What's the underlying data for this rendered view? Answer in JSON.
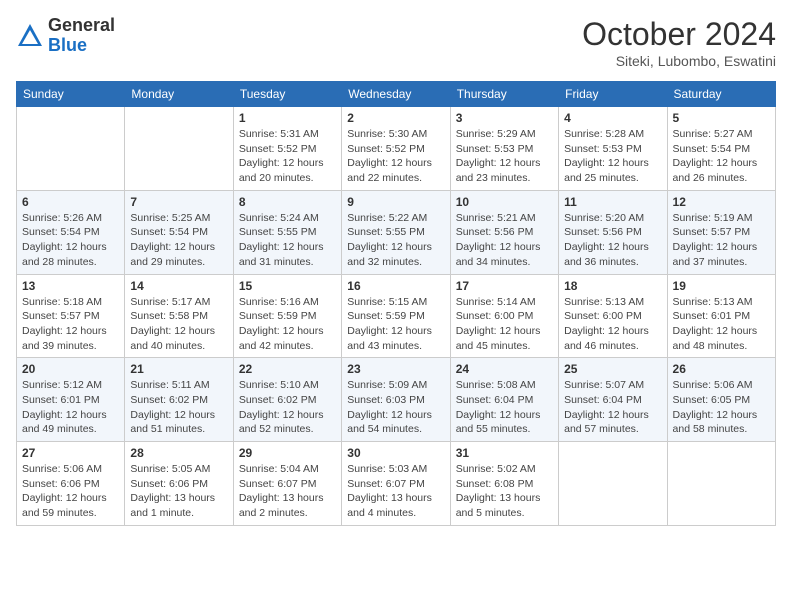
{
  "header": {
    "logo_line1": "General",
    "logo_line2": "Blue",
    "month": "October 2024",
    "location": "Siteki, Lubombo, Eswatini"
  },
  "days_of_week": [
    "Sunday",
    "Monday",
    "Tuesday",
    "Wednesday",
    "Thursday",
    "Friday",
    "Saturday"
  ],
  "weeks": [
    [
      {
        "day": "",
        "info": ""
      },
      {
        "day": "",
        "info": ""
      },
      {
        "day": "1",
        "info": "Sunrise: 5:31 AM\nSunset: 5:52 PM\nDaylight: 12 hours and 20 minutes."
      },
      {
        "day": "2",
        "info": "Sunrise: 5:30 AM\nSunset: 5:52 PM\nDaylight: 12 hours and 22 minutes."
      },
      {
        "day": "3",
        "info": "Sunrise: 5:29 AM\nSunset: 5:53 PM\nDaylight: 12 hours and 23 minutes."
      },
      {
        "day": "4",
        "info": "Sunrise: 5:28 AM\nSunset: 5:53 PM\nDaylight: 12 hours and 25 minutes."
      },
      {
        "day": "5",
        "info": "Sunrise: 5:27 AM\nSunset: 5:54 PM\nDaylight: 12 hours and 26 minutes."
      }
    ],
    [
      {
        "day": "6",
        "info": "Sunrise: 5:26 AM\nSunset: 5:54 PM\nDaylight: 12 hours and 28 minutes."
      },
      {
        "day": "7",
        "info": "Sunrise: 5:25 AM\nSunset: 5:54 PM\nDaylight: 12 hours and 29 minutes."
      },
      {
        "day": "8",
        "info": "Sunrise: 5:24 AM\nSunset: 5:55 PM\nDaylight: 12 hours and 31 minutes."
      },
      {
        "day": "9",
        "info": "Sunrise: 5:22 AM\nSunset: 5:55 PM\nDaylight: 12 hours and 32 minutes."
      },
      {
        "day": "10",
        "info": "Sunrise: 5:21 AM\nSunset: 5:56 PM\nDaylight: 12 hours and 34 minutes."
      },
      {
        "day": "11",
        "info": "Sunrise: 5:20 AM\nSunset: 5:56 PM\nDaylight: 12 hours and 36 minutes."
      },
      {
        "day": "12",
        "info": "Sunrise: 5:19 AM\nSunset: 5:57 PM\nDaylight: 12 hours and 37 minutes."
      }
    ],
    [
      {
        "day": "13",
        "info": "Sunrise: 5:18 AM\nSunset: 5:57 PM\nDaylight: 12 hours and 39 minutes."
      },
      {
        "day": "14",
        "info": "Sunrise: 5:17 AM\nSunset: 5:58 PM\nDaylight: 12 hours and 40 minutes."
      },
      {
        "day": "15",
        "info": "Sunrise: 5:16 AM\nSunset: 5:59 PM\nDaylight: 12 hours and 42 minutes."
      },
      {
        "day": "16",
        "info": "Sunrise: 5:15 AM\nSunset: 5:59 PM\nDaylight: 12 hours and 43 minutes."
      },
      {
        "day": "17",
        "info": "Sunrise: 5:14 AM\nSunset: 6:00 PM\nDaylight: 12 hours and 45 minutes."
      },
      {
        "day": "18",
        "info": "Sunrise: 5:13 AM\nSunset: 6:00 PM\nDaylight: 12 hours and 46 minutes."
      },
      {
        "day": "19",
        "info": "Sunrise: 5:13 AM\nSunset: 6:01 PM\nDaylight: 12 hours and 48 minutes."
      }
    ],
    [
      {
        "day": "20",
        "info": "Sunrise: 5:12 AM\nSunset: 6:01 PM\nDaylight: 12 hours and 49 minutes."
      },
      {
        "day": "21",
        "info": "Sunrise: 5:11 AM\nSunset: 6:02 PM\nDaylight: 12 hours and 51 minutes."
      },
      {
        "day": "22",
        "info": "Sunrise: 5:10 AM\nSunset: 6:02 PM\nDaylight: 12 hours and 52 minutes."
      },
      {
        "day": "23",
        "info": "Sunrise: 5:09 AM\nSunset: 6:03 PM\nDaylight: 12 hours and 54 minutes."
      },
      {
        "day": "24",
        "info": "Sunrise: 5:08 AM\nSunset: 6:04 PM\nDaylight: 12 hours and 55 minutes."
      },
      {
        "day": "25",
        "info": "Sunrise: 5:07 AM\nSunset: 6:04 PM\nDaylight: 12 hours and 57 minutes."
      },
      {
        "day": "26",
        "info": "Sunrise: 5:06 AM\nSunset: 6:05 PM\nDaylight: 12 hours and 58 minutes."
      }
    ],
    [
      {
        "day": "27",
        "info": "Sunrise: 5:06 AM\nSunset: 6:06 PM\nDaylight: 12 hours and 59 minutes."
      },
      {
        "day": "28",
        "info": "Sunrise: 5:05 AM\nSunset: 6:06 PM\nDaylight: 13 hours and 1 minute."
      },
      {
        "day": "29",
        "info": "Sunrise: 5:04 AM\nSunset: 6:07 PM\nDaylight: 13 hours and 2 minutes."
      },
      {
        "day": "30",
        "info": "Sunrise: 5:03 AM\nSunset: 6:07 PM\nDaylight: 13 hours and 4 minutes."
      },
      {
        "day": "31",
        "info": "Sunrise: 5:02 AM\nSunset: 6:08 PM\nDaylight: 13 hours and 5 minutes."
      },
      {
        "day": "",
        "info": ""
      },
      {
        "day": "",
        "info": ""
      }
    ]
  ]
}
